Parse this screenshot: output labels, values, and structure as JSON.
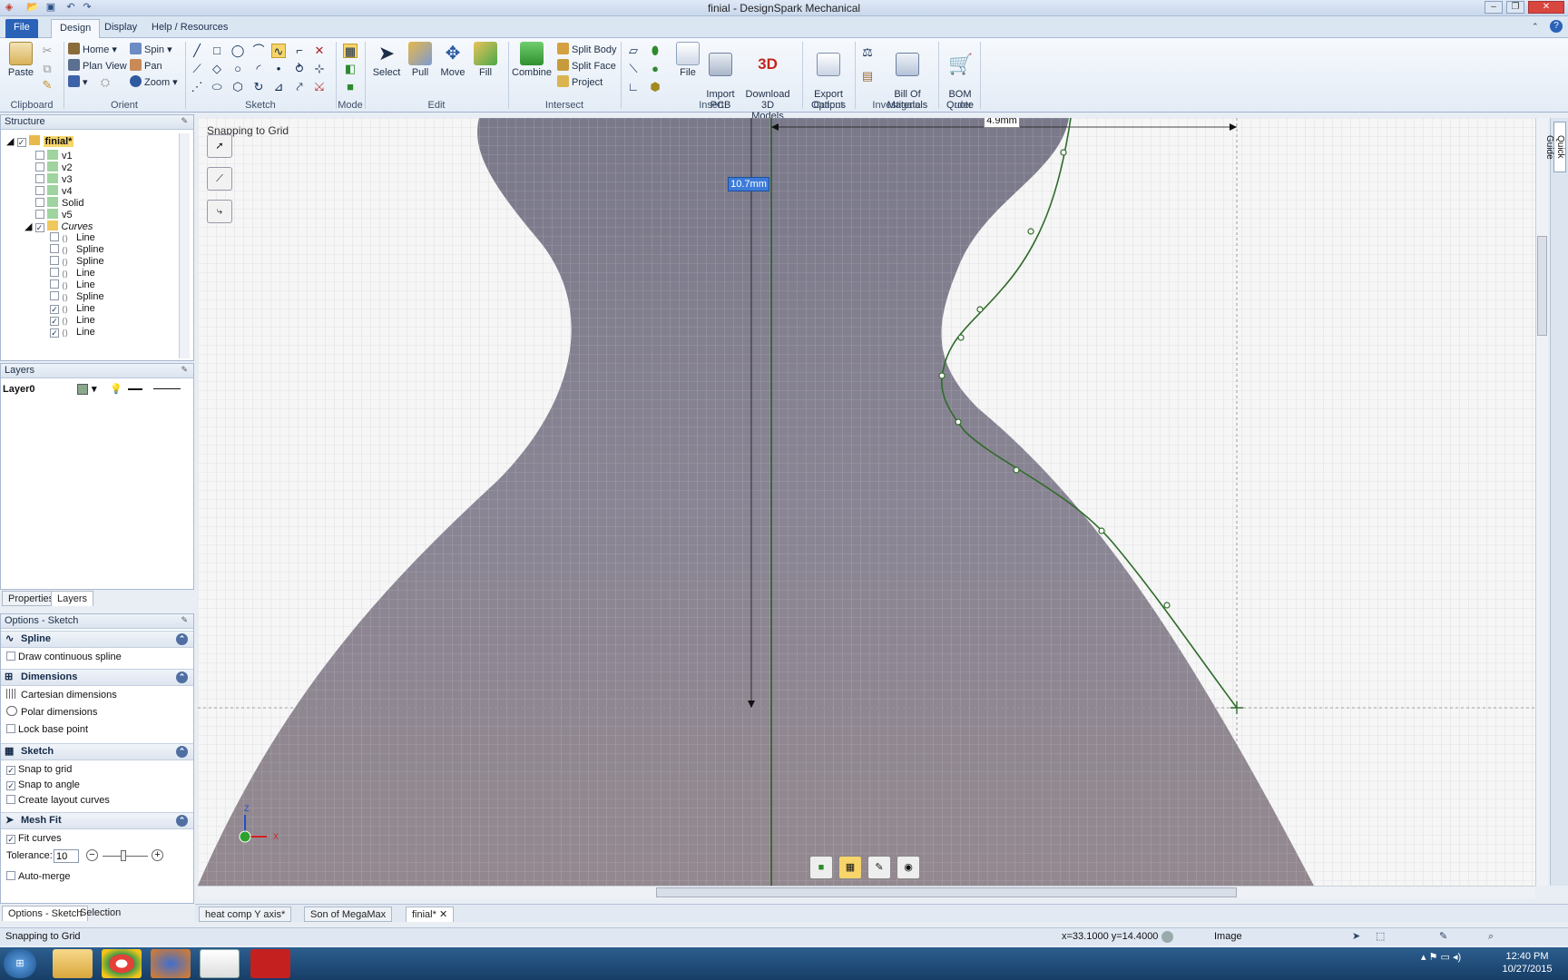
{
  "window": {
    "title": "finial - DesignSpark Mechanical"
  },
  "ribbon_tabs": [
    "File",
    "Design",
    "Display",
    "Help / Resources"
  ],
  "ribbon": {
    "clipboard": {
      "paste": "Paste",
      "label": "Clipboard"
    },
    "orient": {
      "home": "Home",
      "spin": "Spin",
      "plan_view": "Plan View",
      "pan": "Pan",
      "zoom": "Zoom",
      "label": "Orient"
    },
    "sketch_label": "Sketch",
    "mode_label": "Mode",
    "edit": {
      "select": "Select",
      "pull": "Pull",
      "move": "Move",
      "fill": "Fill",
      "label": "Edit"
    },
    "intersect": {
      "combine": "Combine",
      "split_body": "Split Body",
      "split_face": "Split Face",
      "project": "Project",
      "label": "Intersect"
    },
    "insert": {
      "file": "File",
      "import_pcb": "Import\nPCB",
      "download_3d": "Download 3D\nModels",
      "label": "Insert"
    },
    "output": {
      "export": "Export\nOptions",
      "label": "Output"
    },
    "investigate": {
      "bom": "Bill Of\nMaterials",
      "label": "Investigate"
    },
    "order": {
      "bom_quote": "BOM\nQuote",
      "label": "Order"
    },
    "download_badge": "3D"
  },
  "structure": {
    "title": "Structure",
    "root": "finial*",
    "items": [
      {
        "label": "v1",
        "checked": false
      },
      {
        "label": "v2",
        "checked": false
      },
      {
        "label": "v3",
        "checked": false
      },
      {
        "label": "v4",
        "checked": false
      },
      {
        "label": "Solid",
        "checked": false
      }
    ],
    "item_v5": "v5",
    "curves_label": "Curves",
    "curves": [
      {
        "label": "Line",
        "checked": false
      },
      {
        "label": "Spline",
        "checked": false
      },
      {
        "label": "Spline",
        "checked": false
      },
      {
        "label": "Line",
        "checked": false
      },
      {
        "label": "Line",
        "checked": false
      },
      {
        "label": "Spline",
        "checked": false
      },
      {
        "label": "Line",
        "checked": true
      },
      {
        "label": "Line",
        "checked": true
      },
      {
        "label": "Line",
        "checked": true
      }
    ]
  },
  "layers": {
    "title": "Layers",
    "layer_name": "Layer0"
  },
  "panel_tabs": [
    "Properties",
    "Layers"
  ],
  "options": {
    "title": "Options - Sketch",
    "spline": {
      "title": "Spline",
      "draw_continuous": "Draw continuous spline"
    },
    "dimensions": {
      "title": "Dimensions",
      "cartesian": "Cartesian dimensions",
      "polar": "Polar dimensions",
      "lock_base": "Lock base point"
    },
    "sketch": {
      "title": "Sketch",
      "snap_grid": "Snap to grid",
      "snap_angle": "Snap to angle",
      "layout_curves": "Create layout curves"
    },
    "mesh_fit": {
      "title": "Mesh Fit",
      "fit_curves": "Fit curves",
      "tolerance_label": "Tolerance:",
      "tolerance_value": "10",
      "auto_merge": "Auto-merge"
    }
  },
  "bottom_panel_tabs": [
    "Options - Sketch",
    "Selection"
  ],
  "viewport": {
    "mode_text": "Snapping to Grid",
    "dim_horizontal": "4.9mm",
    "dim_vertical": "10.7mm",
    "quick_guide": "Quick Guide",
    "axis_z": "Z",
    "axis_x": "X"
  },
  "doc_tabs": [
    "heat comp Y axis*",
    "Son of MegaMax",
    "finial*"
  ],
  "status": {
    "left": "Snapping to Grid",
    "coords": "x=33.1000  y=14.4000",
    "image_label": "Image"
  },
  "taskbar": {
    "time": "12:40 PM",
    "date": "10/27/2015"
  },
  "colors": {
    "accent": "#2a62b8",
    "spline": "#2f6b2a",
    "mesh": "#7c7a8e"
  }
}
